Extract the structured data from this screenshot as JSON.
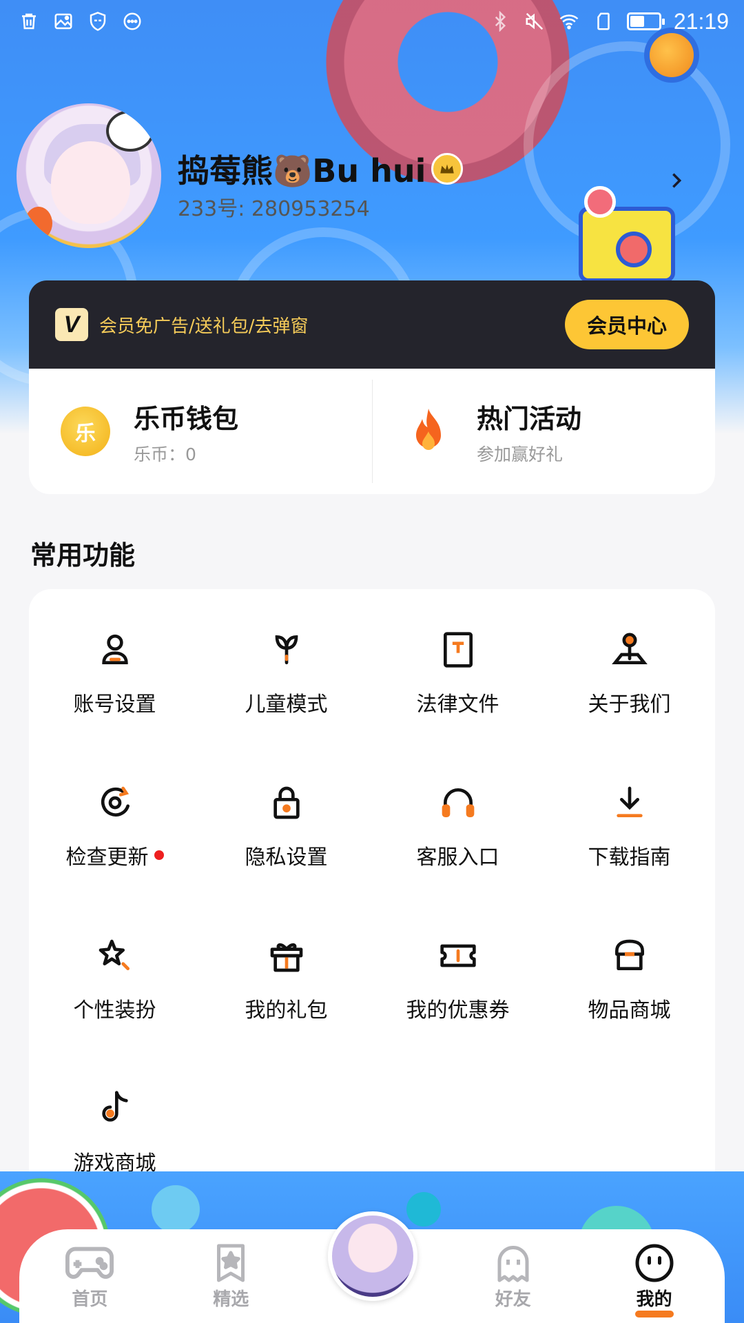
{
  "status_bar": {
    "time": "21:19",
    "left_icons": [
      "trash-icon",
      "image-icon",
      "shield-icon",
      "more-dots-icon"
    ],
    "right_icons": [
      "bluetooth-icon",
      "mute-icon",
      "wifi-icon",
      "sim-icon",
      "battery-icon"
    ]
  },
  "profile": {
    "username": "捣莓熊🐻Bu hui",
    "user_id": "233号: 280953254"
  },
  "vip": {
    "logo": "V",
    "promo": "会员免广告/送礼包/去弹窗",
    "button_label": "会员中心"
  },
  "wallet": {
    "title": "乐币钱包",
    "subtitle": "乐币：0",
    "coin_glyph": "乐"
  },
  "activity": {
    "title": "热门活动",
    "subtitle": "参加赢好礼"
  },
  "functions": {
    "section_title": "常用功能",
    "items": [
      {
        "label": "账号设置",
        "icon": "user-icon"
      },
      {
        "label": "儿童模式",
        "icon": "sprout-icon"
      },
      {
        "label": "法律文件",
        "icon": "document-icon"
      },
      {
        "label": "关于我们",
        "icon": "joystick-icon"
      },
      {
        "label": "检查更新",
        "icon": "refresh-icon",
        "badge": true
      },
      {
        "label": "隐私设置",
        "icon": "lock-icon"
      },
      {
        "label": "客服入口",
        "icon": "headset-icon"
      },
      {
        "label": "下载指南",
        "icon": "download-icon"
      },
      {
        "label": "个性装扮",
        "icon": "star-wand-icon"
      },
      {
        "label": "我的礼包",
        "icon": "gift-icon"
      },
      {
        "label": "我的优惠券",
        "icon": "ticket-icon"
      },
      {
        "label": "物品商城",
        "icon": "shop-icon"
      },
      {
        "label": "游戏商城",
        "icon": "tiktok-icon"
      }
    ]
  },
  "nav": {
    "items": [
      {
        "label": "首页",
        "icon": "gamepad-icon"
      },
      {
        "label": "精选",
        "icon": "star-bookmark-icon"
      },
      {
        "label": "好友",
        "icon": "ghost-icon"
      },
      {
        "label": "我的",
        "icon": "smiley-icon",
        "active": true
      }
    ]
  },
  "colors": {
    "accent": "#f57a1f",
    "vip_gold": "#fdc635",
    "hero_blue": "#3f9bff",
    "badge_red": "#ee1f1f"
  }
}
